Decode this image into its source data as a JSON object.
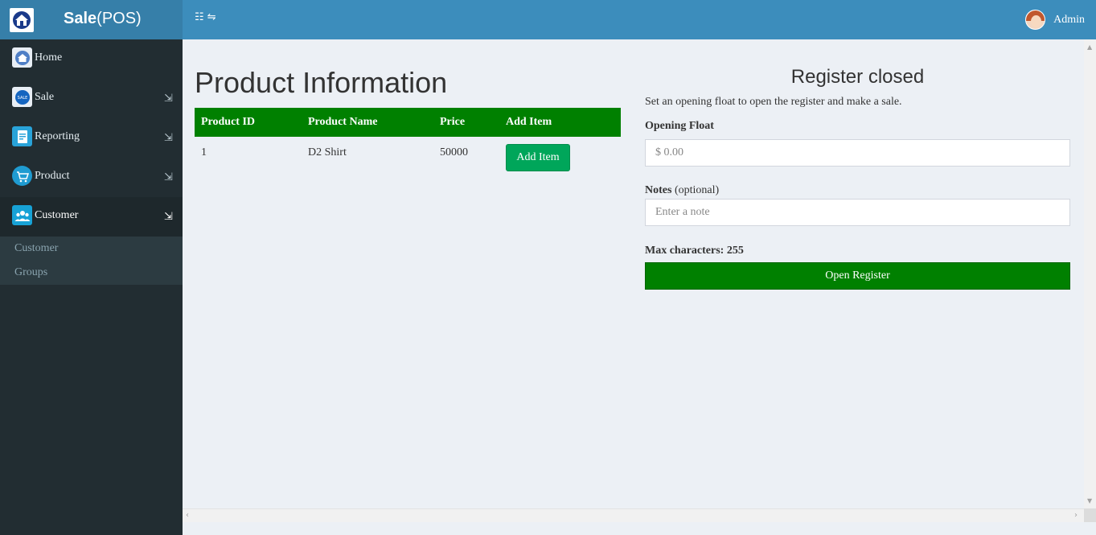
{
  "brand": {
    "bold": "Sale",
    "rest": "(POS)"
  },
  "topbar": {
    "toggle_icon": "☷ ⇋",
    "user_name": "Admin"
  },
  "sidebar": {
    "items": [
      {
        "label": "Home",
        "icon": "home-icon",
        "icon_color": "#3c8dbc",
        "arrow": ""
      },
      {
        "label": "Sale",
        "icon": "sale-icon",
        "icon_color": "#1565c0",
        "arrow": "⇲"
      },
      {
        "label": "Reporting",
        "icon": "report-icon",
        "icon_color": "#29a3d9",
        "arrow": "⇲"
      },
      {
        "label": "Product",
        "icon": "cart-icon",
        "icon_color": "#1f9bd1",
        "arrow": "⇲"
      },
      {
        "label": "Customer",
        "icon": "users-icon",
        "icon_color": "#17a2d6",
        "arrow": "⇲"
      }
    ],
    "sub_items": [
      "Customer",
      "Groups"
    ]
  },
  "main": {
    "title": "Product Information",
    "table": {
      "headers": [
        "Product ID",
        "Product Name",
        "Price",
        "Add Item"
      ],
      "rows": [
        {
          "id": "1",
          "name": "D2 Shirt",
          "price": "50000",
          "button": "Add Item"
        }
      ]
    }
  },
  "register": {
    "title": "Register closed",
    "description": "Set an opening float to open the register and make a sale.",
    "float_label": "Opening Float",
    "float_placeholder": "$ 0.00",
    "notes_label": "Notes",
    "notes_optional": "(optional)",
    "notes_placeholder": "Enter a note",
    "max_chars": "Max characters: 255",
    "open_button": "Open Register"
  },
  "colors": {
    "header": "#3c8dbc",
    "brand": "#367fa9",
    "sidebar": "#222d32",
    "table_header": "#008000",
    "add_button": "#00a65a"
  }
}
